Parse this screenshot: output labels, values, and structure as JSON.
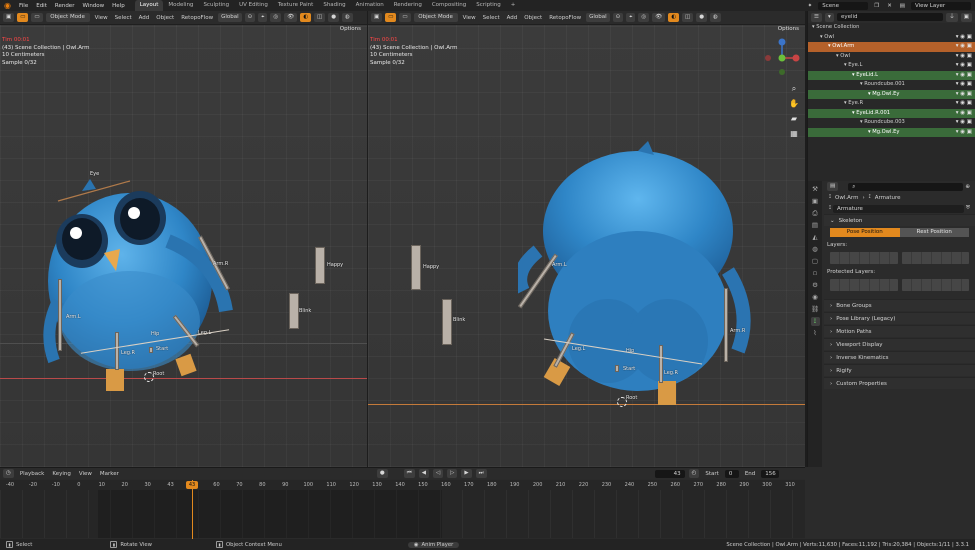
{
  "topbar": {
    "menus": [
      "File",
      "Edit",
      "Render",
      "Window",
      "Help"
    ],
    "workspaces": [
      "Layout",
      "Modeling",
      "Sculpting",
      "UV Editing",
      "Texture Paint",
      "Shading",
      "Animation",
      "Rendering",
      "Compositing",
      "Scripting"
    ],
    "active_workspace": "Layout",
    "add_tab": "+",
    "scene_label": "Scene",
    "view_layer_label": "View Layer"
  },
  "viewport_left": {
    "mode": "Object Mode",
    "menus": [
      "View",
      "Select",
      "Add",
      "Object"
    ],
    "retopoflow": "RetopoFlow",
    "orientation": "Global",
    "options": "Options",
    "info": {
      "timecode": "Tim 00:01",
      "collection": "(43) Scene Collection | Owl.Arm",
      "units": "10 Centimeters",
      "sample": "Sample 0/32"
    },
    "labels": [
      "Happy",
      "Blink",
      "Arm.R",
      "Arm.L",
      "Hip",
      "Leg.L",
      "Leg.R",
      "Start",
      "Root",
      "Eye"
    ]
  },
  "viewport_right": {
    "mode": "Object Mode",
    "menus": [
      "View",
      "Select",
      "Add",
      "Object"
    ],
    "retopoflow": "RetopoFlow",
    "orientation": "Global",
    "options": "Options",
    "info": {
      "timecode": "Tim 00:01",
      "collection": "(43) Scene Collection | Owl.Arm",
      "units": "10 Centimeters",
      "sample": "Sample 0/32"
    },
    "labels": [
      "Happy",
      "Blink",
      "Arm.L",
      "Arm.R",
      "Hip",
      "Leg.L",
      "Leg.R",
      "Start",
      "Root"
    ]
  },
  "outliner": {
    "search": "eyelid",
    "rows": [
      {
        "label": "Scene Collection",
        "indent": 0,
        "state": "none"
      },
      {
        "label": "Owl",
        "indent": 1,
        "state": "none"
      },
      {
        "label": "Owl.Arm",
        "indent": 2,
        "state": "selected"
      },
      {
        "label": "Owl",
        "indent": 3,
        "state": "none"
      },
      {
        "label": "Eye.L",
        "indent": 4,
        "state": "none"
      },
      {
        "label": "EyeLid.L",
        "indent": 5,
        "state": "highlight"
      },
      {
        "label": "Roundcube.001",
        "indent": 6,
        "state": "none"
      },
      {
        "label": "Mg.Owl.Ey",
        "indent": 7,
        "state": "highlight"
      },
      {
        "label": "Eye.R",
        "indent": 4,
        "state": "none"
      },
      {
        "label": "EyeLid.R.001",
        "indent": 5,
        "state": "highlight"
      },
      {
        "label": "Roundcube.003",
        "indent": 6,
        "state": "none"
      },
      {
        "label": "Mg.Owl.Ey",
        "indent": 7,
        "state": "highlight"
      }
    ]
  },
  "properties": {
    "breadcrumb_object": "Owl.Arm",
    "breadcrumb_data": "Armature",
    "data_name": "Armature",
    "skeleton_panel": "Skeleton",
    "pose_position": "Pose Position",
    "rest_position": "Rest Position",
    "layers_label": "Layers:",
    "protected_layers_label": "Protected Layers:",
    "panels": [
      "Bone Groups",
      "Pose Library (Legacy)",
      "Motion Paths",
      "Viewport Display",
      "Inverse Kinematics",
      "Rigify",
      "Custom Properties"
    ]
  },
  "timeline": {
    "menus": [
      "Playback",
      "Keying",
      "View",
      "Marker"
    ],
    "current_frame": "43",
    "start_label": "Start",
    "start": "0",
    "end_label": "End",
    "end": "156",
    "ruler": [
      "-40",
      "-20",
      "-10",
      "0",
      "10",
      "20",
      "30",
      "43",
      "50",
      "60",
      "70",
      "80",
      "90",
      "100",
      "110",
      "120",
      "130",
      "140",
      "150",
      "160",
      "170",
      "180",
      "190",
      "200",
      "210",
      "220",
      "230",
      "240",
      "250",
      "260",
      "270",
      "280",
      "290",
      "300",
      "310"
    ]
  },
  "statusbar": {
    "select": "Select",
    "rotate_view": "Rotate View",
    "context_menu": "Object Context Menu",
    "anim_player": "Anim Player",
    "stats": "Scene Collection | Owl.Arm | Verts:11,630 | Faces:11,192 | Tris:20,384 | Objects:1/11 | 3.3.1"
  },
  "colors": {
    "accent_orange": "#e2891e",
    "selection_orange": "#b5612a",
    "highlight_green": "#3a6b3a",
    "owl_blue": "#3d8fcf"
  }
}
